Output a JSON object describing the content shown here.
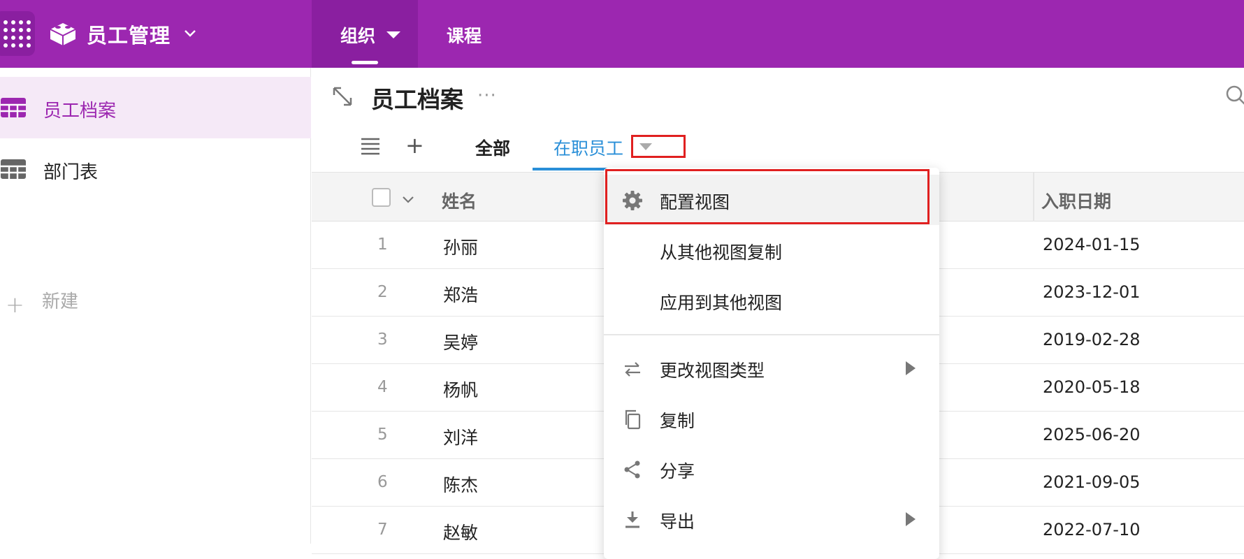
{
  "app": {
    "title": "员工管理"
  },
  "topnav": {
    "tabs": [
      {
        "label": "组织"
      },
      {
        "label": "课程"
      }
    ]
  },
  "sidebar": {
    "items": [
      {
        "label": "员工档案"
      },
      {
        "label": "部门表"
      }
    ],
    "new_label": "新建"
  },
  "main": {
    "title": "员工档案",
    "more": "···",
    "views": {
      "add": "+",
      "tabs": [
        {
          "label": "全部"
        },
        {
          "label": "在职员工"
        }
      ]
    }
  },
  "table": {
    "columns": [
      {
        "label": "姓名"
      },
      {
        "label": "入职日期"
      }
    ],
    "rows": [
      {
        "idx": "1",
        "name": "孙丽",
        "date": "2024-01-15"
      },
      {
        "idx": "2",
        "name": "郑浩",
        "date": "2023-12-01"
      },
      {
        "idx": "3",
        "name": "吴婷",
        "date": "2019-02-28"
      },
      {
        "idx": "4",
        "name": "杨帆",
        "date": "2020-05-18"
      },
      {
        "idx": "5",
        "name": "刘洋",
        "date": "2025-06-20"
      },
      {
        "idx": "6",
        "name": "陈杰",
        "date": "2021-09-05"
      },
      {
        "idx": "7",
        "name": "赵敏",
        "date": "2022-07-10"
      }
    ]
  },
  "menu": {
    "items": [
      {
        "label": "配置视图",
        "icon": "gear-icon"
      },
      {
        "label": "从其他视图复制"
      },
      {
        "label": "应用到其他视图"
      },
      {
        "label": "更改视图类型",
        "icon": "swap-arrows-icon",
        "submenu": true
      },
      {
        "label": "复制",
        "icon": "copy-icon"
      },
      {
        "label": "分享",
        "icon": "share-icon"
      },
      {
        "label": "导出",
        "icon": "download-icon",
        "submenu": true
      }
    ]
  },
  "colors": {
    "brand": "#9c27b0",
    "brand_dark": "#8a1fa0",
    "accent_blue": "#2a8fd8",
    "highlight_red": "#e02020"
  }
}
